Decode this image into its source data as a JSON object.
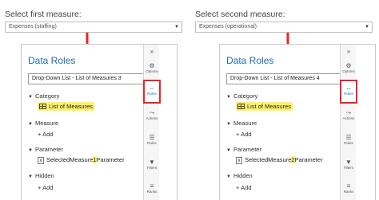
{
  "left": {
    "label": "Select first measure:",
    "select_value": "Expenses (staffing)",
    "panel": {
      "title": "Data Roles",
      "dropdown": "Drop-Down List - List of Measures 3",
      "category": "Category",
      "category_item": "List of Measures",
      "measure": "Measure",
      "add": "Add",
      "parameter": "Parameter",
      "param_prefix": "SelectedMeasure",
      "param_num": "1",
      "param_suffix": "Parameter",
      "hidden": "Hidden",
      "add2": "Add"
    }
  },
  "right": {
    "label": "Select second measure:",
    "select_value": "Expenses (operational)",
    "panel": {
      "title": "Data Roles",
      "dropdown": "Drop-Down List - List of Measures 4",
      "category": "Category",
      "category_item": "List of Measures",
      "measure": "Measure",
      "add": "Add",
      "parameter": "Parameter",
      "param_prefix": "SelectedMeasure",
      "param_num": "2",
      "param_suffix": "Parameter",
      "hidden": "Hidden",
      "add2": "Add"
    }
  },
  "sidebar": {
    "expand": "»",
    "options": "Options",
    "roles": "Roles",
    "actions": "Actions",
    "rules": "Rules",
    "filters": "Filters",
    "ranks": "Ranks"
  },
  "colors": {
    "accent": "#1f6bb5",
    "highlight": "#fff26b",
    "callout": "#e3262b"
  }
}
